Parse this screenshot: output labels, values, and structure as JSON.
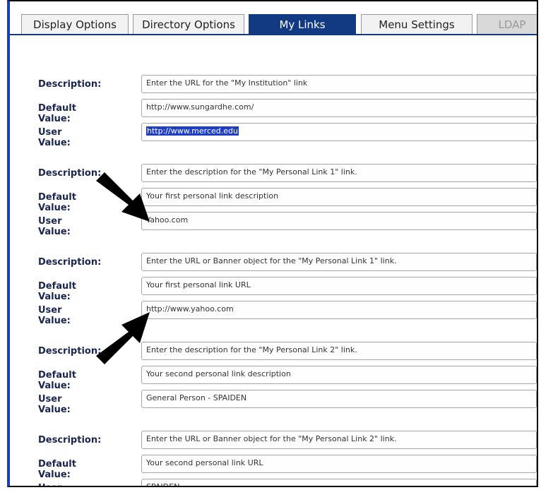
{
  "tabs": [
    {
      "label": "Display Options"
    },
    {
      "label": "Directory Options"
    },
    {
      "label": "My Links"
    },
    {
      "label": "Menu Settings"
    },
    {
      "label": "LDAP"
    }
  ],
  "labels": {
    "description": "Description:",
    "default_value": "Default Value:",
    "user_value": "User Value:"
  },
  "groups": [
    {
      "description": "Enter the URL for the \"My Institution\" link",
      "default_value": "http://www.sungardhe.com/",
      "user_value": "http://www.merced.edu"
    },
    {
      "description": "Enter the description for the \"My Personal Link 1\" link.",
      "default_value": "Your first personal link description",
      "user_value": "Yahoo.com"
    },
    {
      "description": "Enter the URL or Banner object for the \"My Personal Link 1\" link.",
      "default_value": "Your first personal link URL",
      "user_value": "http://www.yahoo.com"
    },
    {
      "description": "Enter the description for the \"My Personal Link 2\" link.",
      "default_value": "Your second personal link description",
      "user_value": "General Person - SPAIDEN"
    },
    {
      "description": "Enter the URL or Banner object for the \"My Personal Link 2\" link.",
      "default_value": "Your second personal link URL",
      "user_value": "SPAIDEN"
    }
  ]
}
